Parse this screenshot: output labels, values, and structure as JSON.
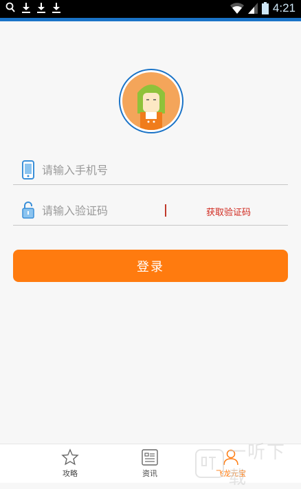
{
  "status_bar": {
    "time": "4:21",
    "left_icons": [
      "search-icon",
      "download-icon",
      "download-icon",
      "download-icon"
    ],
    "right_icons": [
      "wifi-icon",
      "signal-icon",
      "battery-icon"
    ]
  },
  "login": {
    "phone_placeholder": "请输入手机号",
    "code_placeholder": "请输入验证码",
    "get_code_label": "获取验证码",
    "submit_label": "登录"
  },
  "bottom_nav": {
    "items": [
      {
        "label": "攻略",
        "icon": "star-icon",
        "active": false
      },
      {
        "label": "资讯",
        "icon": "news-icon",
        "active": false
      },
      {
        "label": "飞龙元宝",
        "icon": "user-icon",
        "active": true
      }
    ]
  },
  "watermark": {
    "text": "一听下载"
  },
  "colors": {
    "accent": "#ff7b0f",
    "status_blue": "#1a73c7",
    "get_code_red": "#d0281e",
    "avatar_bg": "#f4a55a"
  }
}
